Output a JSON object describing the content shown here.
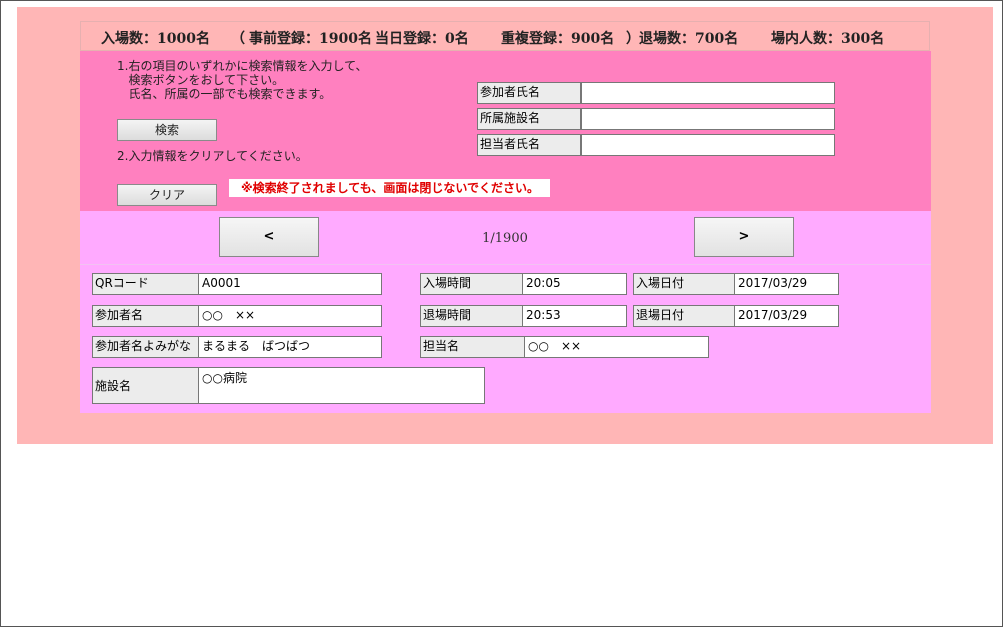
{
  "stats": {
    "entered": "入場数：1000名",
    "open_paren": "（",
    "pre_registered": "事前登録：1900名",
    "same_day": "当日登録：0名",
    "duplicate": "重複登録：900名",
    "close_paren": "）",
    "exited": "退場数：700名",
    "inside": "場内人数：300名"
  },
  "search": {
    "instruction_1": "1.右の項目のいずれかに検索情報を入力して、\n   検索ボタンをおして下さい。\n   氏名、所属の一部でも検索できます。",
    "search_button": "検索",
    "instruction_2": "2.入力情報をクリアしてください。",
    "clear_button": "クリア",
    "warning": "※検索終了されましても、画面は閉じないでください。",
    "fields": [
      {
        "label": "参加者氏名",
        "value": ""
      },
      {
        "label": "所属施設名",
        "value": ""
      },
      {
        "label": "担当者氏名",
        "value": ""
      }
    ]
  },
  "pager": {
    "prev": "<",
    "next": ">",
    "info": "1/1900"
  },
  "record": {
    "qr_label": "QRコード",
    "qr_value": "A0001",
    "name_label": "参加者名",
    "name_value": "○○　××",
    "kana_label": "参加者名よみがな",
    "kana_value": "まるまる　ばつばつ",
    "facility_label": "施設名",
    "facility_value": "○○病院",
    "entry_time_label": "入場時間",
    "entry_time_value": "20:05",
    "exit_time_label": "退場時間",
    "exit_time_value": "20:53",
    "staff_label": "担当名",
    "staff_value": "○○　××",
    "entry_date_label": "入場日付",
    "entry_date_value": "2017/03/29",
    "exit_date_label": "退場日付",
    "exit_date_value": "2017/03/29"
  }
}
